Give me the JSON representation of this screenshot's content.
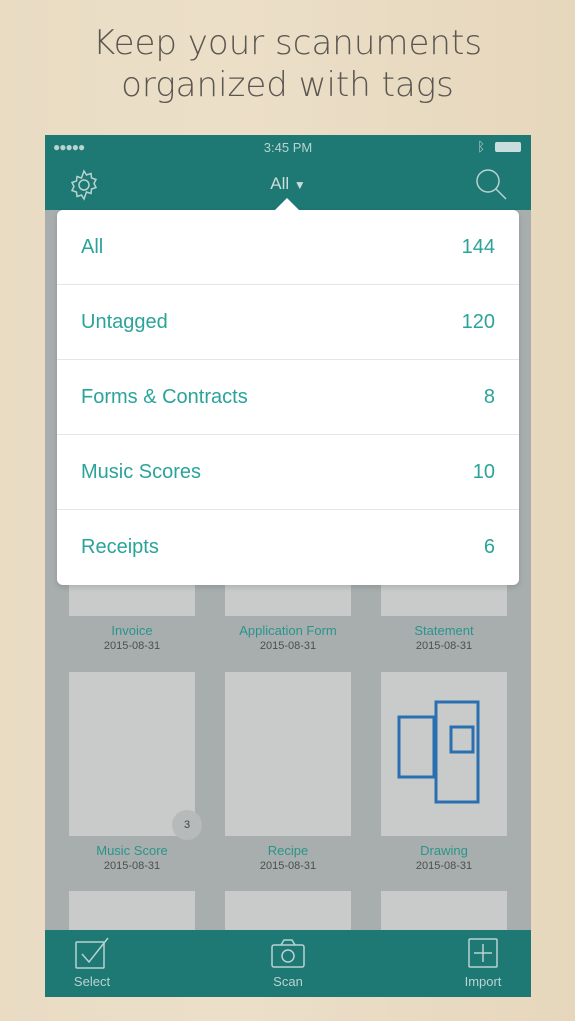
{
  "headline": [
    "Keep your scanuments",
    "organized with tags"
  ],
  "status": {
    "time": "3:45 PM",
    "signal": "●●●●●"
  },
  "nav": {
    "title": "All",
    "title_icon": "caret-down-icon",
    "left_icon": "gear-icon",
    "right_icon": "search-icon"
  },
  "dropdown": [
    {
      "label": "All",
      "count": "144"
    },
    {
      "label": "Untagged",
      "count": "120"
    },
    {
      "label": "Forms & Contracts",
      "count": "8"
    },
    {
      "label": "Music Scores",
      "count": "10"
    },
    {
      "label": "Receipts",
      "count": "6"
    }
  ],
  "documents": [
    {
      "name": "Invoice",
      "date": "2015-08-31"
    },
    {
      "name": "Application Form",
      "date": "2015-08-31"
    },
    {
      "name": "Statement",
      "date": "2015-08-31"
    },
    {
      "name": "Music Score",
      "date": "2015-08-31",
      "pages": "3"
    },
    {
      "name": "Recipe",
      "date": "2015-08-31"
    },
    {
      "name": "Drawing",
      "date": "2015-08-31"
    }
  ],
  "tabbar": {
    "select": "Select",
    "scan": "Scan",
    "import": "Import"
  },
  "colors": {
    "brand": "#1e7874",
    "accent": "#2aa49a"
  }
}
